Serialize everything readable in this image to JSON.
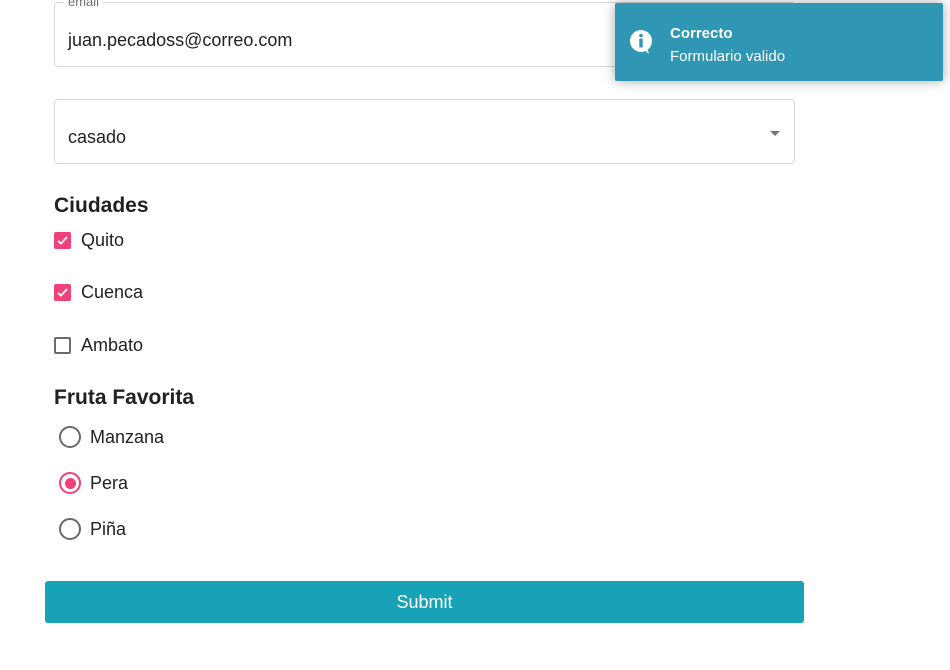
{
  "form": {
    "email": {
      "label": "email",
      "value": "juan.pecadoss@correo.com"
    },
    "estado_civil": {
      "selected": "casado"
    },
    "ciudades": {
      "title": "Ciudades",
      "items": [
        {
          "label": "Quito",
          "checked": true
        },
        {
          "label": "Cuenca",
          "checked": true
        },
        {
          "label": "Ambato",
          "checked": false
        }
      ]
    },
    "fruta": {
      "title": "Fruta Favorita",
      "options": [
        {
          "label": "Manzana",
          "selected": false
        },
        {
          "label": "Pera",
          "selected": true
        },
        {
          "label": "Piña",
          "selected": false
        }
      ]
    },
    "submit_label": "Submit"
  },
  "toast": {
    "title": "Correcto",
    "message": "Formulario valido",
    "icon": "info-icon"
  },
  "colors": {
    "accent": "#f0417a",
    "submit": "#17a2b8",
    "toast": "#2f96b4"
  }
}
